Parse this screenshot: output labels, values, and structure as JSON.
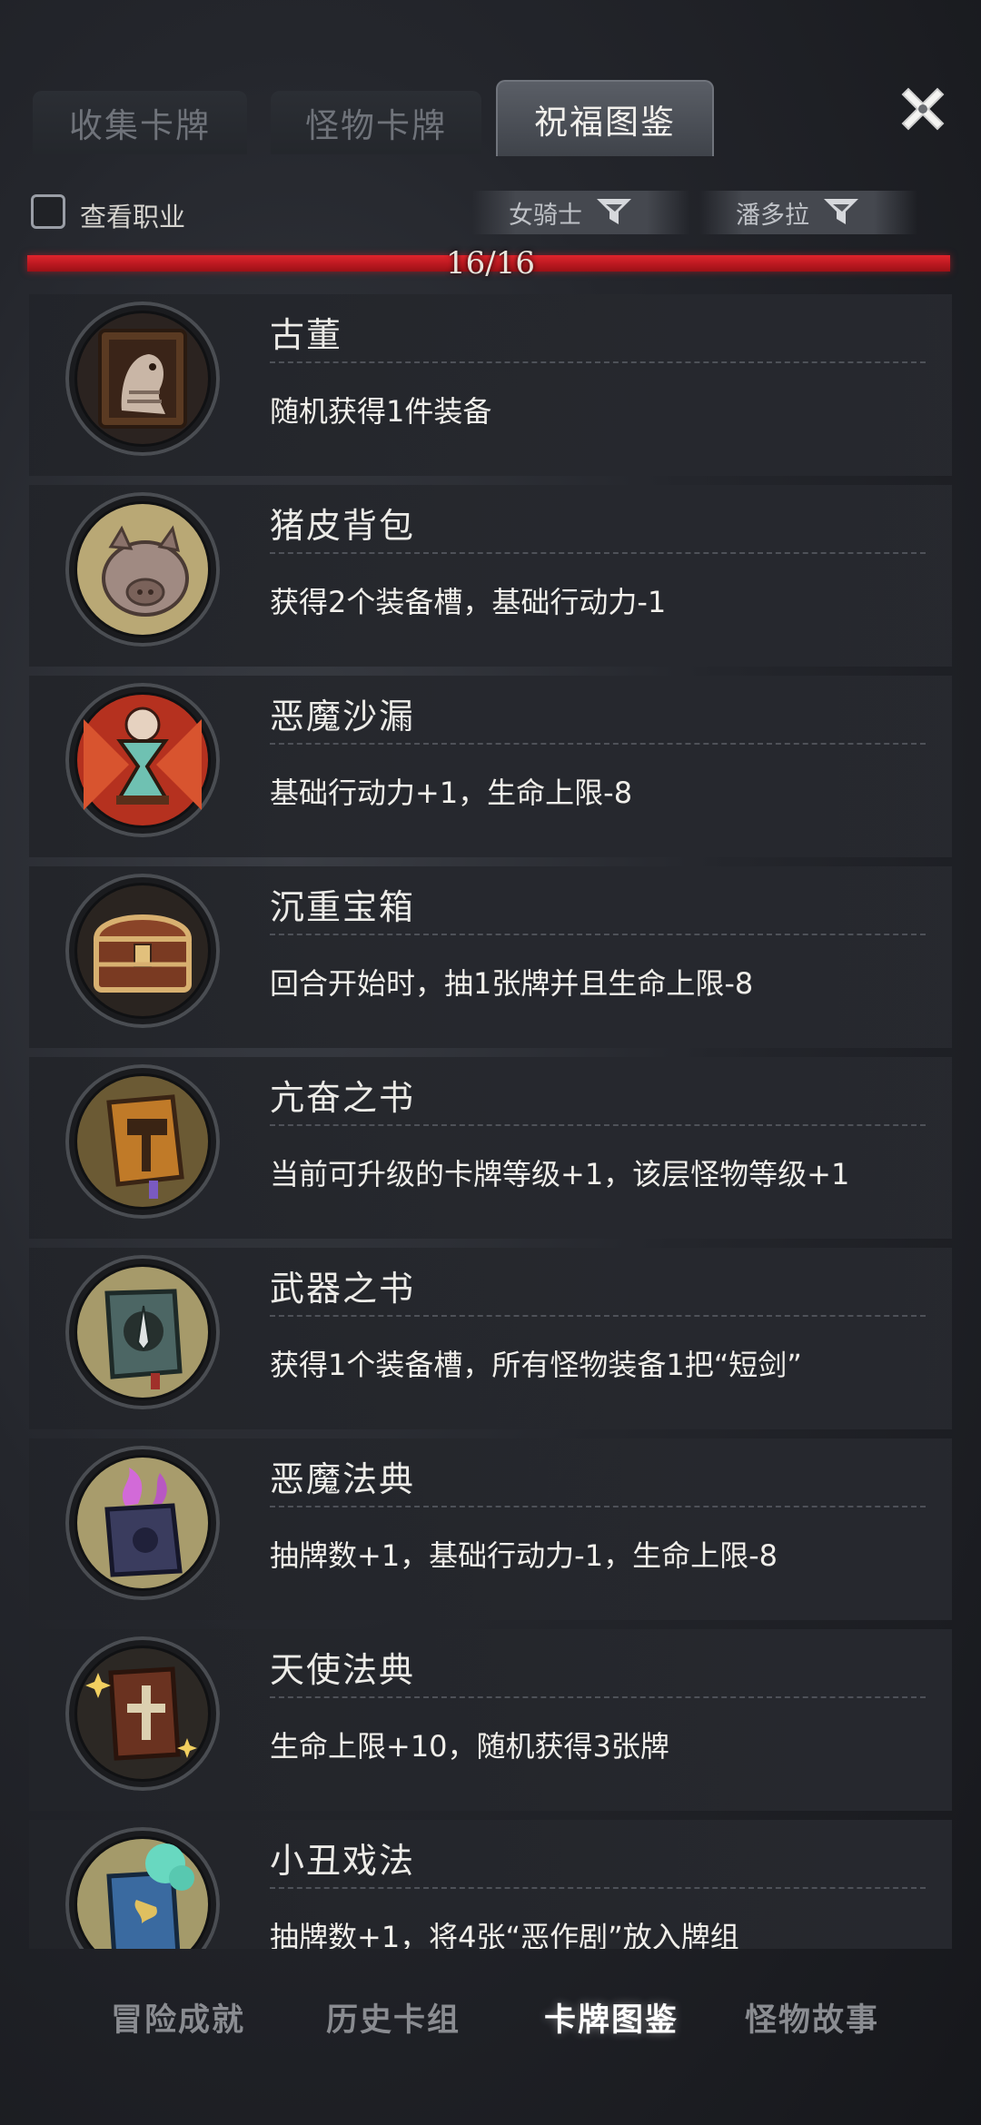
{
  "tabs": [
    {
      "label": "收集卡牌"
    },
    {
      "label": "怪物卡牌"
    },
    {
      "label": "祝福图鉴"
    }
  ],
  "filter": {
    "checkbox_label": "查看职业",
    "chips": [
      {
        "label": "女骑士"
      },
      {
        "label": "潘多拉"
      }
    ]
  },
  "progress": {
    "text": "16/16",
    "fraction": 1.0
  },
  "items": [
    {
      "title": "古董",
      "desc": "随机获得1件装备",
      "icon": "antique-portrait-icon"
    },
    {
      "title": "猪皮背包",
      "desc": "获得2个装备槽，基础行动力-1",
      "icon": "pigskin-backpack-icon"
    },
    {
      "title": "恶魔沙漏",
      "desc": "基础行动力+1，生命上限-8",
      "icon": "demon-hourglass-icon"
    },
    {
      "title": "沉重宝箱",
      "desc": "回合开始时，抽1张牌并且生命上限-8",
      "icon": "heavy-chest-icon"
    },
    {
      "title": "亢奋之书",
      "desc": "当前可升级的卡牌等级+1，该层怪物等级+1",
      "icon": "hammer-book-icon"
    },
    {
      "title": "武器之书",
      "desc": "获得1个装备槽，所有怪物装备1把“短剑”",
      "icon": "sword-book-icon"
    },
    {
      "title": "恶魔法典",
      "desc": "抽牌数+1，基础行动力-1，生命上限-8",
      "icon": "demon-tome-icon"
    },
    {
      "title": "天使法典",
      "desc": "生命上限+10，随机获得3张牌",
      "icon": "angel-tome-icon"
    },
    {
      "title": "小丑戏法",
      "desc": "抽牌数+1，将4张“恶作剧”放入牌组",
      "icon": "jester-book-icon"
    }
  ],
  "bottom_nav": [
    {
      "label": "冒险成就"
    },
    {
      "label": "历史卡组"
    },
    {
      "label": "卡牌图鉴",
      "active": true
    },
    {
      "label": "怪物故事"
    }
  ]
}
